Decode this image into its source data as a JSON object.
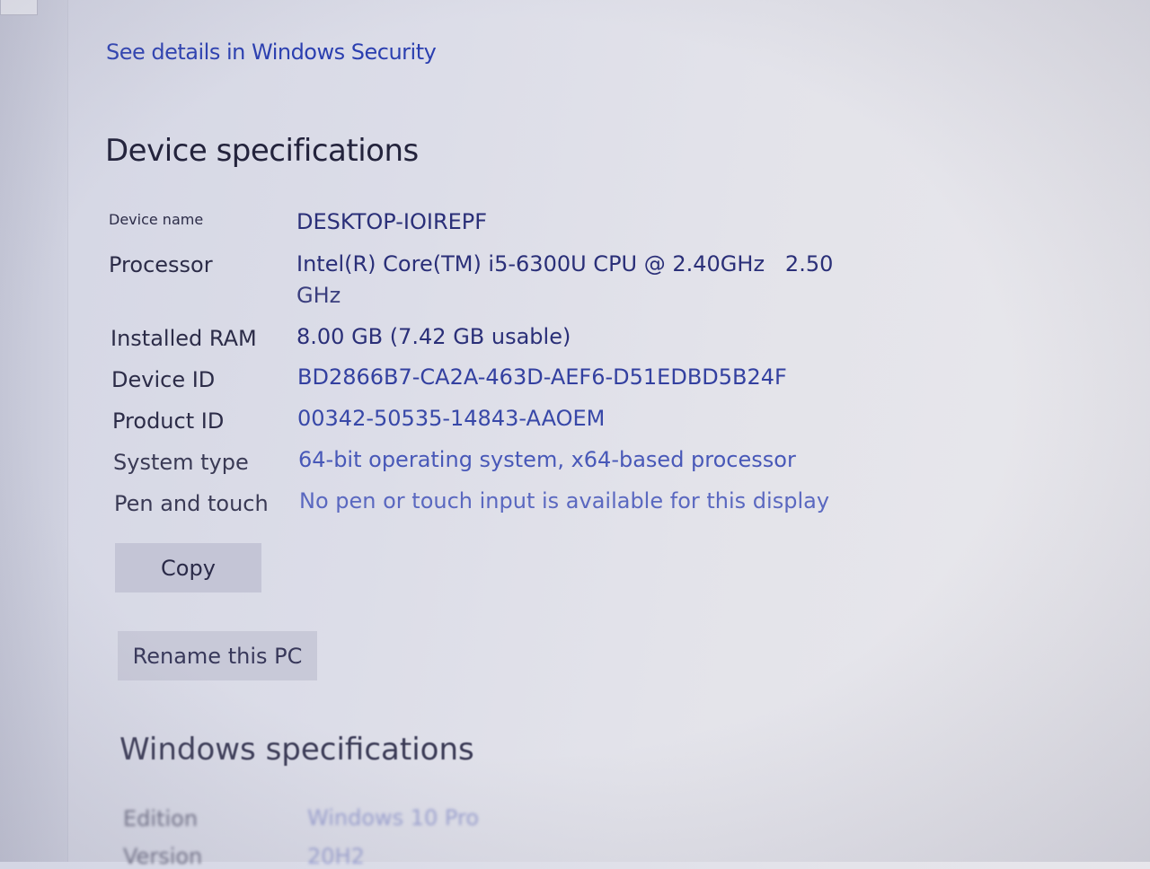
{
  "security_link": "See details in Windows Security",
  "device_section": {
    "title": "Device specifications",
    "rows": [
      {
        "label": "Device name",
        "value": "DESKTOP-IOIREPF"
      },
      {
        "label": "Processor",
        "value": "Intel(R) Core(TM) i5-6300U CPU @ 2.40GHz   2.50",
        "value_cont": "GHz"
      },
      {
        "label": "Installed RAM",
        "value": "8.00 GB (7.42 GB usable)"
      },
      {
        "label": "Device ID",
        "value": "BD2866B7-CA2A-463D-AEF6-D51EDBD5B24F"
      },
      {
        "label": "Product ID",
        "value": "00342-50535-14843-AAOEM"
      },
      {
        "label": "System type",
        "value": "64-bit operating system, x64-based processor"
      },
      {
        "label": "Pen and touch",
        "value": "No pen or touch input is available for this display"
      }
    ],
    "copy_button": "Copy",
    "rename_button": "Rename this PC"
  },
  "windows_section": {
    "title": "Windows specifications",
    "rows": [
      {
        "label": "Edition",
        "value": "Windows 10 Pro"
      },
      {
        "label": "Version",
        "value": "20H2"
      }
    ]
  }
}
